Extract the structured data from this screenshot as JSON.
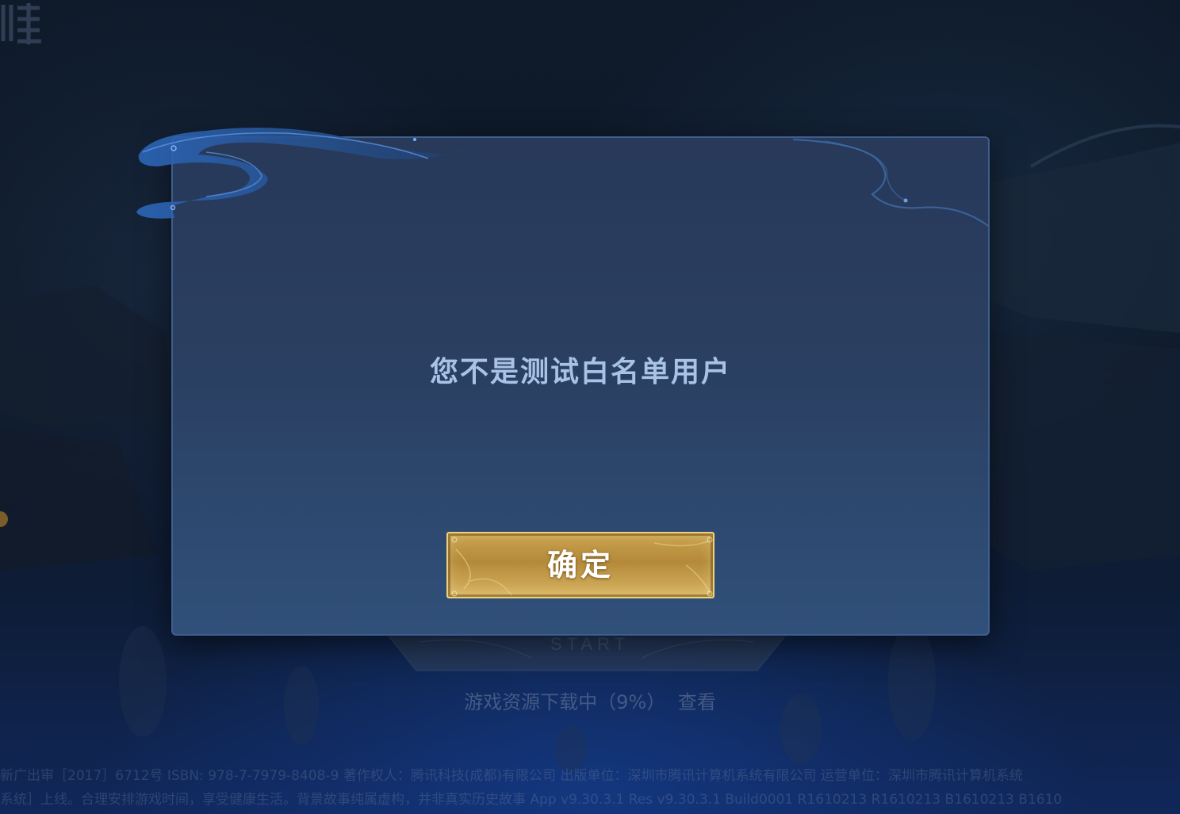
{
  "background": {
    "start_button_sub": "START",
    "download_status": {
      "text": "游戏资源下载中（9%）",
      "progress_percent": 9,
      "view_link": "查看"
    },
    "legal_line_1": "新广出审［2017］6712号 ISBN: 978-7-7979-8408-9 著作权人：腾讯科技(成都)有限公司 出版单位：深圳市腾讯计算机系统有限公司 运营单位：深圳市腾讯计算机系统",
    "legal_line_2": "系统］上线。合理安排游戏时间，享受健康生活。背景故事纯属虚构，并非真实历史故事 App v9.30.3.1 Res v9.30.3.1 Build0001 R1610213 R1610213 B1610213 B1610"
  },
  "dialog": {
    "message": "您不是测试白名单用户",
    "confirm_label": "确定"
  },
  "colors": {
    "dialog_bg": "#2a3f61",
    "dialog_border": "#3e5f8d",
    "message_text": "#a9c3e6",
    "button_gold": "#c9a24e",
    "button_border": "#f0d27a"
  }
}
